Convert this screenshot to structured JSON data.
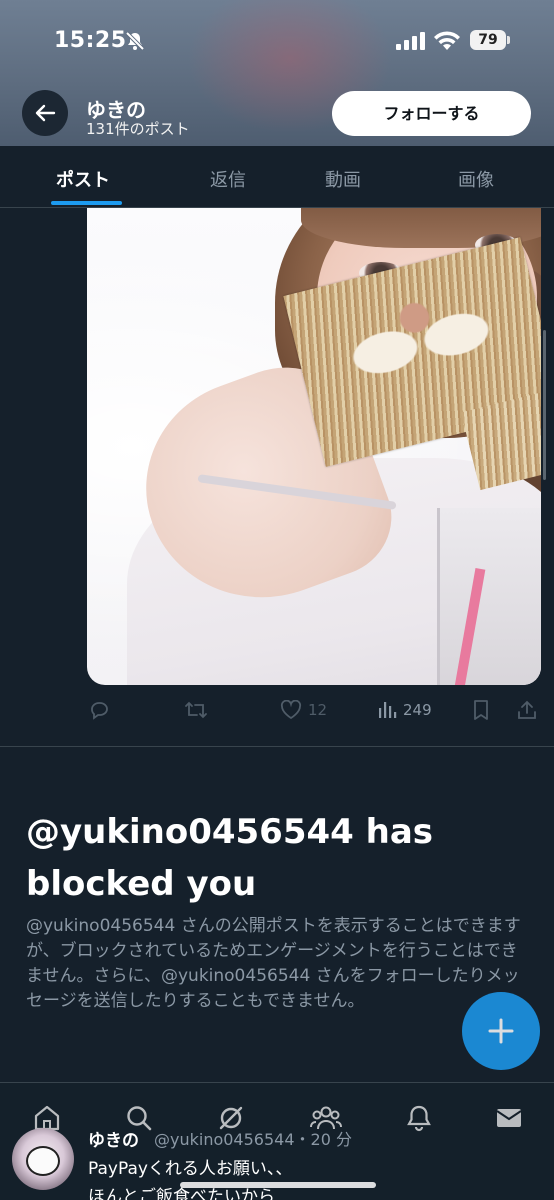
{
  "status_bar": {
    "time": "15:25",
    "battery": "79",
    "icons": [
      "bell-off-icon",
      "signal-icon",
      "wifi-icon",
      "battery-icon"
    ]
  },
  "header": {
    "name": "ゆきの",
    "post_count": "131件のポスト",
    "follow_label": "フォローする",
    "back_icon": "arrow-left-icon"
  },
  "tabs": [
    {
      "label": "ポスト",
      "active": true
    },
    {
      "label": "返信",
      "active": false
    },
    {
      "label": "動画",
      "active": false
    },
    {
      "label": "画像",
      "active": false
    }
  ],
  "post_actions": {
    "likes": "12",
    "views": "249",
    "icons": [
      "reply-icon",
      "repost-icon",
      "like-icon",
      "views-icon",
      "bookmark-icon",
      "share-icon"
    ]
  },
  "blocked": {
    "title": "@yukino0456544 has blocked you",
    "body": "@yukino0456544 さんの公開ポストを表示することはできますが、ブロックされているためエンゲージメントを行うことはできません。さらに、@yukino0456544 さんをフォローしたりメッセージを送信したりすることもできません。"
  },
  "fab": {
    "label": "+"
  },
  "bottom_nav": [
    "home-icon",
    "search-icon",
    "grok-icon",
    "communities-icon",
    "notifications-icon",
    "messages-icon"
  ],
  "peek_post": {
    "name": "ゆきの",
    "handle": "@yukino0456544・20 分",
    "line1": "PayPayくれる人お願い、、",
    "line2": "ほんとご飯食べたいから"
  },
  "colors": {
    "background": "#15202b",
    "accent": "#1d9bf0",
    "muted_text": "#8b98a5",
    "border": "#38444d"
  }
}
